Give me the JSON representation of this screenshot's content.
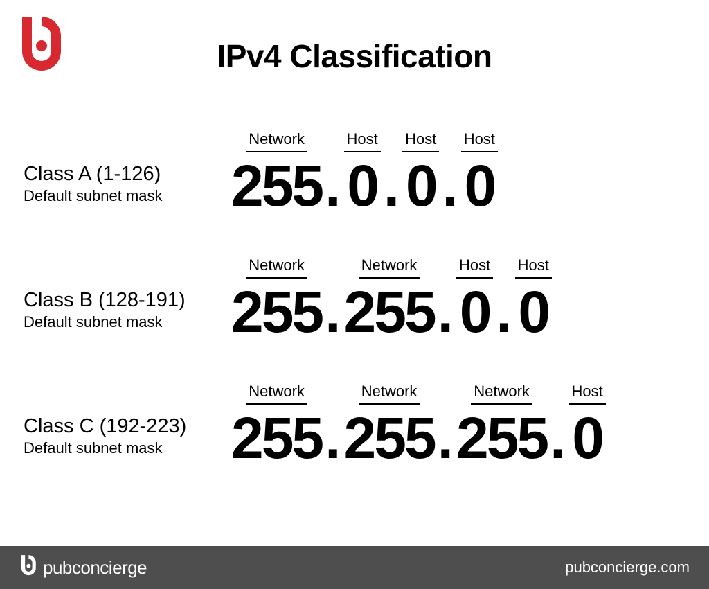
{
  "title": "IPv4 Classification",
  "classes": [
    {
      "name": "Class A (1-126)",
      "sub": "Default subnet mask",
      "octets": [
        {
          "label": "Network",
          "value": "255"
        },
        {
          "label": "Host",
          "value": "0"
        },
        {
          "label": "Host",
          "value": "0"
        },
        {
          "label": "Host",
          "value": "0"
        }
      ]
    },
    {
      "name": "Class B (128-191)",
      "sub": "Default subnet mask",
      "octets": [
        {
          "label": "Network",
          "value": "255"
        },
        {
          "label": "Network",
          "value": "255"
        },
        {
          "label": "Host",
          "value": "0"
        },
        {
          "label": "Host",
          "value": "0"
        }
      ]
    },
    {
      "name": "Class C (192-223)",
      "sub": "Default subnet mask",
      "octets": [
        {
          "label": "Network",
          "value": "255"
        },
        {
          "label": "Network",
          "value": "255"
        },
        {
          "label": "Network",
          "value": "255"
        },
        {
          "label": "Host",
          "value": "0"
        }
      ]
    }
  ],
  "footer": {
    "brand": "pubconcierge",
    "url": "pubconcierge.com"
  },
  "dot": "."
}
